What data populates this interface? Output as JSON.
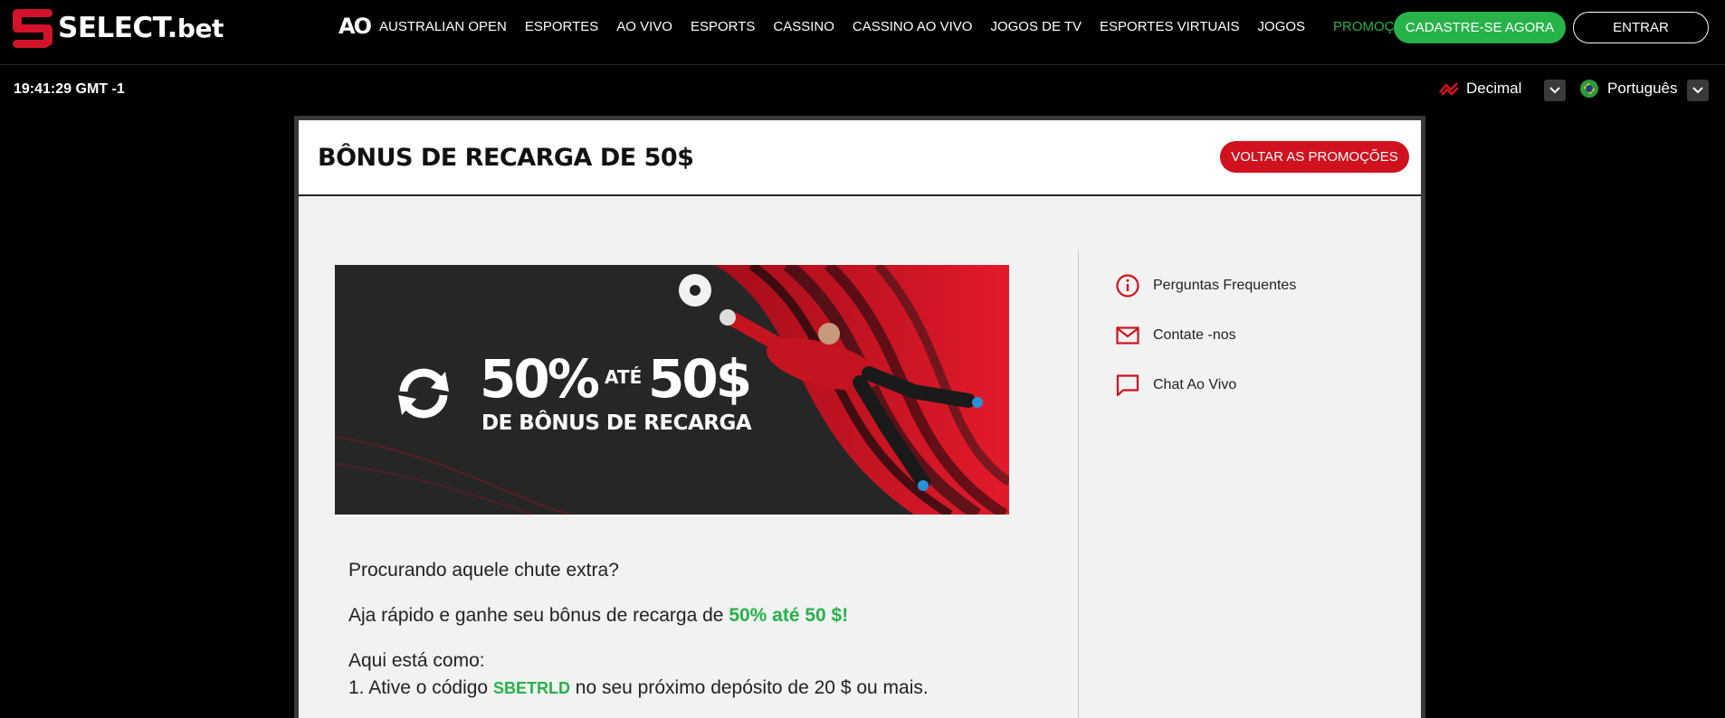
{
  "brand": {
    "logo_main": "SELECT",
    "logo_dot": ".",
    "logo_suffix": "bet"
  },
  "nav": {
    "ao_logo": "AO",
    "items": [
      {
        "label": "AUSTRALIAN OPEN"
      },
      {
        "label": "ESPORTES"
      },
      {
        "label": "AO VIVO"
      },
      {
        "label": "ESPORTS"
      },
      {
        "label": "CASSINO"
      },
      {
        "label": "CASSINO AO VIVO"
      },
      {
        "label": "JOGOS DE TV"
      },
      {
        "label": "ESPORTES VIRTUAIS"
      },
      {
        "label": "JOGOS"
      },
      {
        "label": "PROMOÇÕES"
      }
    ],
    "register_label": "CADASTRE-SE AGORA",
    "login_label": "ENTRAR"
  },
  "subbar": {
    "clock": "19:41:29 GMT -1",
    "odds_format": "Decimal",
    "language": "Português"
  },
  "promo": {
    "title": "BÔNUS DE RECARGA DE 50$",
    "back_label": "VOLTAR AS PROMOÇÕES",
    "banner": {
      "percent": "50%",
      "ate": "ATÉ",
      "amount": "50$",
      "subtitle": "DE BÔNUS DE RECARGA"
    },
    "text": {
      "line1": "Procurando aquele chute extra?",
      "line2_prefix": "Aja rápido e ganhe seu bônus de recarga de ",
      "line2_highlight": "50% até 50 $!",
      "line3": "Aqui está como:",
      "line4_prefix": "1. Ative o código ",
      "line4_code": "SBETRLD",
      "line4_suffix": " no seu próximo depósito de 20 $ ou mais."
    }
  },
  "sidebar": {
    "items": [
      {
        "label": "Perguntas Frequentes",
        "icon": "info-icon"
      },
      {
        "label": "Contate -nos",
        "icon": "mail-icon"
      },
      {
        "label": "Chat Ao Vivo",
        "icon": "chat-icon"
      }
    ]
  },
  "colors": {
    "accent_red": "#d0111e",
    "accent_green": "#27b24a",
    "background": "#000000",
    "panel": "#f2f2f2"
  }
}
